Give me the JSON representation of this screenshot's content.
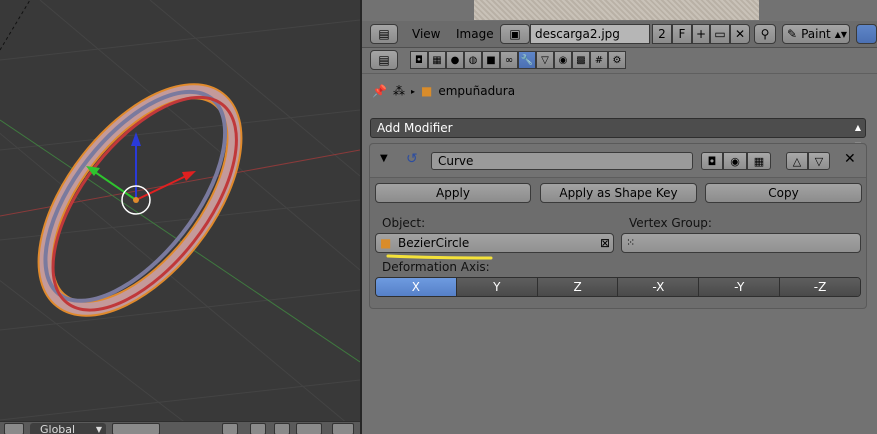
{
  "viewport": {
    "orientation": {
      "label": "Global"
    },
    "icons": [
      "manipulator-icon",
      "pivot-icon",
      "snap-icon"
    ]
  },
  "header": {
    "menus": {
      "view": "View",
      "image": "Image"
    },
    "image_name": "descarga2.jpg",
    "users": "2",
    "fake_user": "F",
    "mode": "Paint"
  },
  "properties": {
    "breadcrumb": {
      "object": "empuñadura"
    },
    "add_modifier": "Add Modifier",
    "modifier": {
      "name": "Curve",
      "buttons": {
        "apply": "Apply",
        "apply_shape": "Apply as Shape Key",
        "copy": "Copy"
      },
      "object_label": "Object:",
      "object_value": "BezierCircle",
      "vertex_group_label": "Vertex Group:",
      "vertex_group_value": "",
      "deformation_label": "Deformation Axis:",
      "axes": [
        "X",
        "Y",
        "Z",
        "-X",
        "-Y",
        "-Z"
      ],
      "active_axis": "X"
    }
  },
  "colors": {
    "active_blue": "#5b86cd",
    "annotation_yellow": "#f4e23a",
    "ring_outline": "#e08a2c"
  }
}
